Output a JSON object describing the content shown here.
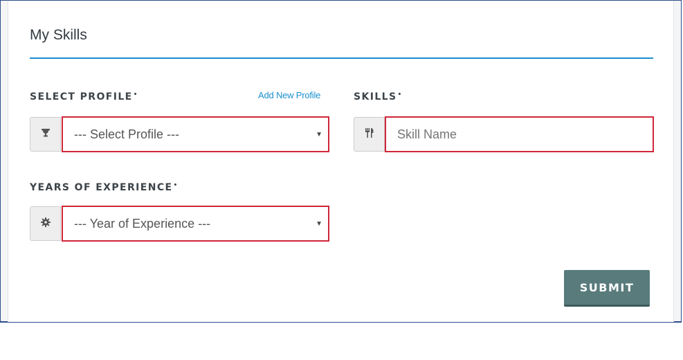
{
  "section": {
    "title": "My Skills"
  },
  "select_profile": {
    "label": "SELECT PROFILE",
    "required_mark": "•",
    "add_link": "Add New Profile",
    "icon": "trophy-icon",
    "value": "--- Select Profile ---"
  },
  "skills": {
    "label": "SKILLS",
    "required_mark": "•",
    "icon": "cutlery-icon",
    "placeholder": "Skill Name"
  },
  "experience": {
    "label": "YEARS OF EXPERIENCE",
    "required_mark": "•",
    "icon": "gear-icon",
    "value": "--- Year of Experience ---"
  },
  "actions": {
    "submit_label": "SUBMIT"
  },
  "colors": {
    "accent": "#1a8fd0",
    "error_border": "#d0263a",
    "submit_bg": "#597b7c",
    "frame_border": "#2b4c8a"
  }
}
